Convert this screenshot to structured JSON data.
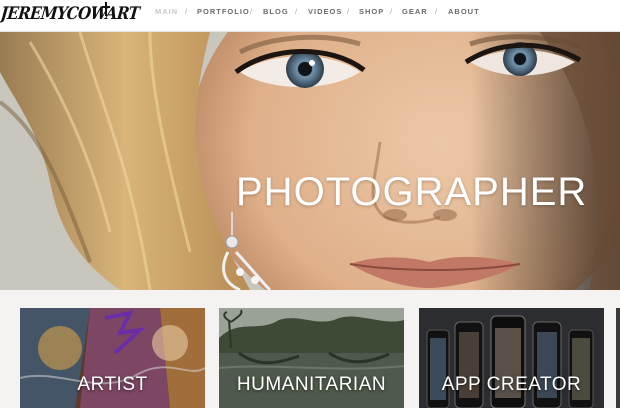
{
  "header": {
    "logo_text": "JEREMYCOWART",
    "nav": [
      {
        "label": "MAIN",
        "active": true
      },
      {
        "label": "PORTFOLIO",
        "active": false
      },
      {
        "label": "BLOG",
        "active": false
      },
      {
        "label": "VIDEOS",
        "active": false
      },
      {
        "label": "SHOP",
        "active": false
      },
      {
        "label": "GEAR",
        "active": false
      },
      {
        "label": "ABOUT",
        "active": false
      }
    ],
    "separator": "/"
  },
  "hero": {
    "title": "PHOTOGRAPHER"
  },
  "cards": [
    {
      "label": "ARTIST"
    },
    {
      "label": "HUMANITARIAN"
    },
    {
      "label": "APP CREATOR"
    }
  ],
  "colors": {
    "nav_text": "#6a6a6a",
    "nav_active": "#c9c9c9",
    "page_background": "#f4f3f1"
  }
}
